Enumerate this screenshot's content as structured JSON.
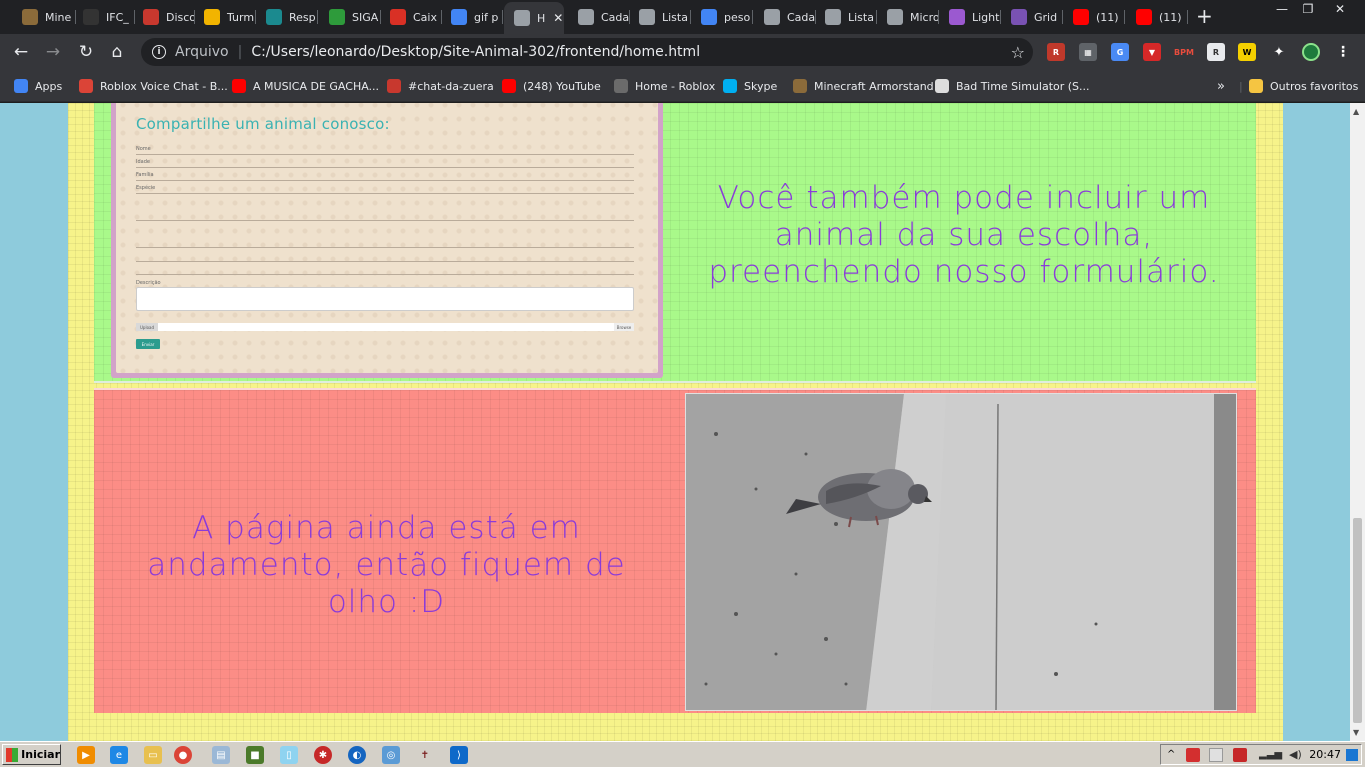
{
  "tabs": [
    {
      "label": "Mine",
      "icon": "minecraft-armorstand-icon",
      "color": "#8b6b3a"
    },
    {
      "label": "IFC_",
      "icon": "github-icon",
      "color": "#333333"
    },
    {
      "label": "Disco",
      "icon": "rpg-icon",
      "color": "#c8382e"
    },
    {
      "label": "Turm",
      "icon": "classroom-icon",
      "color": "#f2b400"
    },
    {
      "label": "Resp",
      "icon": "classroom-icon",
      "color": "#1b8a8f"
    },
    {
      "label": "SIGA",
      "icon": "siga-icon",
      "color": "#2e9b3b"
    },
    {
      "label": "Caix",
      "icon": "gmail-icon",
      "color": "#d93025"
    },
    {
      "label": "gif p",
      "icon": "google-icon",
      "color": "#4285f4"
    },
    {
      "label": "H",
      "icon": "globe-icon",
      "color": "#9aa0a6",
      "active": true
    },
    {
      "label": "Cada",
      "icon": "globe-icon",
      "color": "#9aa0a6"
    },
    {
      "label": "Lista",
      "icon": "globe-icon",
      "color": "#9aa0a6"
    },
    {
      "label": "peso",
      "icon": "google-icon",
      "color": "#4285f4"
    },
    {
      "label": "Cada",
      "icon": "globe-icon",
      "color": "#9aa0a6"
    },
    {
      "label": "Lista",
      "icon": "globe-icon",
      "color": "#9aa0a6"
    },
    {
      "label": "Micro",
      "icon": "globe-icon",
      "color": "#9aa0a6"
    },
    {
      "label": "Light",
      "icon": "lightpaint-icon",
      "color": "#9b59d0"
    },
    {
      "label": "Grid",
      "icon": "bootstrap-icon",
      "color": "#7952b3"
    },
    {
      "label": "(11)",
      "icon": "youtube-icon",
      "color": "#ff0000"
    },
    {
      "label": "(11)",
      "icon": "youtube-icon",
      "color": "#ff0000"
    }
  ],
  "address": {
    "scheme": "Arquivo",
    "url": "C:/Users/leonardo/Desktop/Site-Animal-302/frontend/home.html"
  },
  "bookmarks": [
    {
      "label": "Apps",
      "icon": "apps-grid-icon",
      "color": "#4285f4"
    },
    {
      "label": "Roblox Voice Chat - B...",
      "icon": "chrome-icon",
      "color": "#db4437"
    },
    {
      "label": "A MUSICA DE GACHA...",
      "icon": "youtube-icon",
      "color": "#ff0000"
    },
    {
      "label": "#chat-da-zuera",
      "icon": "rpg-icon",
      "color": "#c8382e"
    },
    {
      "label": "(248) YouTube",
      "icon": "youtube-icon",
      "color": "#ff0000"
    },
    {
      "label": "Home - Roblox",
      "icon": "roblox-icon",
      "color": "#6b6b6b"
    },
    {
      "label": "Skype",
      "icon": "skype-icon",
      "color": "#00aff0"
    },
    {
      "label": "Minecraft Armorstand",
      "icon": "minecraft-armorstand-icon",
      "color": "#8b6b3a"
    },
    {
      "label": "Bad Time Simulator (S...",
      "icon": "sans-skull-icon",
      "color": "#dddddd"
    }
  ],
  "other_bookmarks": "Outros favoritos",
  "form": {
    "title": "Compartilhe um animal conosco:",
    "labels": [
      "Nome",
      "Idade",
      "Família",
      "Espécie",
      "Descrição"
    ],
    "upload_button": "Upload",
    "browse_button": "Browse",
    "submit_label": "Enviar"
  },
  "message_include": "Você também pode incluir um animal da sua escolha, preenchendo nosso formulário.",
  "message_progress": "A página ainda está em andamento, então fiquem de olho :D",
  "taskbar": {
    "start_label": "Iniciar",
    "clock": "20:47"
  }
}
